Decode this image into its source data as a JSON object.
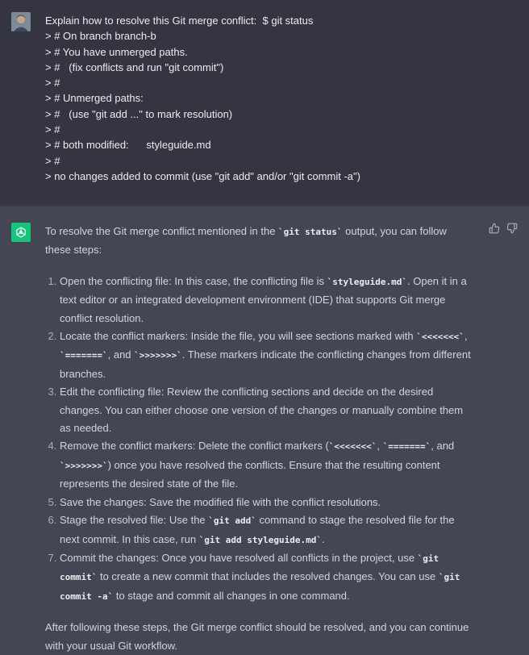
{
  "user_message": {
    "lines": [
      "Explain how to resolve this Git merge conflict:  $ git status",
      "> # On branch branch-b",
      "> # You have unmerged paths.",
      "> #   (fix conflicts and run \"git commit\")",
      "> #",
      "> # Unmerged paths:",
      "> #   (use \"git add ...\" to mark resolution)",
      "> #",
      "> # both modified:      styleguide.md",
      "> #",
      "> no changes added to commit (use \"git add\" and/or \"git commit -a\")"
    ]
  },
  "assistant_message": {
    "intro": [
      {
        "t": "text",
        "v": "To resolve the Git merge conflict mentioned in the "
      },
      {
        "t": "code",
        "v": "`git status`"
      },
      {
        "t": "text",
        "v": " output, you can follow these steps:"
      }
    ],
    "steps": [
      [
        {
          "t": "text",
          "v": "Open the conflicting file: In this case, the conflicting file is "
        },
        {
          "t": "code",
          "v": "`styleguide.md`"
        },
        {
          "t": "text",
          "v": ". Open it in a text editor or an integrated development environment (IDE) that supports Git merge conflict resolution."
        }
      ],
      [
        {
          "t": "text",
          "v": "Locate the conflict markers: Inside the file, you will see sections marked with "
        },
        {
          "t": "code",
          "v": "`<<<<<<<`"
        },
        {
          "t": "text",
          "v": ", "
        },
        {
          "t": "code",
          "v": "`=======`"
        },
        {
          "t": "text",
          "v": ", and "
        },
        {
          "t": "code",
          "v": "`>>>>>>>`"
        },
        {
          "t": "text",
          "v": ". These markers indicate the conflicting changes from different branches."
        }
      ],
      [
        {
          "t": "text",
          "v": "Edit the conflicting file: Review the conflicting sections and decide on the desired changes. You can either choose one version of the changes or manually combine them as needed."
        }
      ],
      [
        {
          "t": "text",
          "v": "Remove the conflict markers: Delete the conflict markers ("
        },
        {
          "t": "code",
          "v": "`<<<<<<<`"
        },
        {
          "t": "text",
          "v": ", "
        },
        {
          "t": "code",
          "v": "`=======`"
        },
        {
          "t": "text",
          "v": ", and "
        },
        {
          "t": "code",
          "v": "`>>>>>>>`"
        },
        {
          "t": "text",
          "v": ") once you have resolved the conflicts. Ensure that the resulting content represents the desired state of the file."
        }
      ],
      [
        {
          "t": "text",
          "v": "Save the changes: Save the modified file with the conflict resolutions."
        }
      ],
      [
        {
          "t": "text",
          "v": "Stage the resolved file: Use the "
        },
        {
          "t": "code",
          "v": "`git add`"
        },
        {
          "t": "text",
          "v": " command to stage the resolved file for the next commit. In this case, run "
        },
        {
          "t": "code",
          "v": "`git add styleguide.md`"
        },
        {
          "t": "text",
          "v": "."
        }
      ],
      [
        {
          "t": "text",
          "v": "Commit the changes: Once you have resolved all conflicts in the project, use "
        },
        {
          "t": "code",
          "v": "`git commit`"
        },
        {
          "t": "text",
          "v": " to create a new commit that includes the resolved changes. You can use "
        },
        {
          "t": "code",
          "v": "`git commit -a`"
        },
        {
          "t": "text",
          "v": " to stage and commit all changes in one command."
        }
      ]
    ],
    "outro": [
      {
        "t": "text",
        "v": "After following these steps, the Git merge conflict should be resolved, and you can continue with your usual Git workflow."
      }
    ]
  },
  "icons": {
    "user_avatar": "avatar-photo",
    "assistant_avatar": "openai-logo-icon",
    "thumbs_up": "thumbs-up-icon",
    "thumbs_down": "thumbs-down-icon"
  },
  "colors": {
    "user_bg": "#343541",
    "assistant_bg": "#444654",
    "logo_bg": "#19c37d"
  }
}
